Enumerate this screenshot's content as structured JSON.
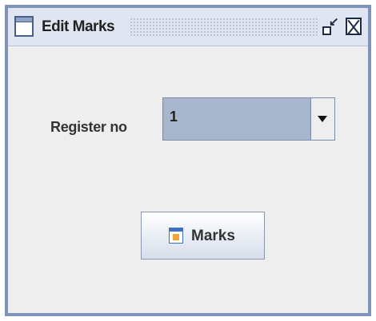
{
  "window": {
    "title": "Edit Marks",
    "icons": {
      "app": "window-icon",
      "minimize": "minimize-icon",
      "close": "close-icon"
    }
  },
  "form": {
    "register_label": "Register no",
    "register_value": "1",
    "dropdown_icon": "chevron-down-icon"
  },
  "actions": {
    "marks_label": "Marks",
    "marks_icon": "marks-icon"
  },
  "colors": {
    "window_border": "#7f94b8",
    "titlebar": "#dfe5f1",
    "combo_fill": "#a7b6cd",
    "panel": "#eeeeee"
  }
}
